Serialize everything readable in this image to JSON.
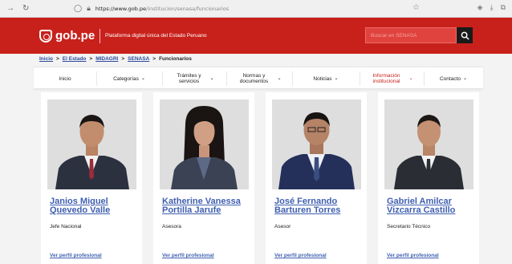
{
  "browser": {
    "url_host": "https://www.gob.pe",
    "url_path": "/institucion/senasa/funcionarios"
  },
  "header": {
    "logo_text": "gob.pe",
    "tagline": "Plataforma digital única del Estado Peruano",
    "search_placeholder": "Buscar en SENASA",
    "brand_color": "#c8211c"
  },
  "breadcrumb": [
    "Inicio",
    "El Estado",
    "MIDAGRI",
    "SENASA",
    "Funcionarios"
  ],
  "menu": [
    {
      "label": "Inicio",
      "chevron": ""
    },
    {
      "label": "Categorías",
      "chevron": "⌄"
    },
    {
      "label": "Trámites y servicios",
      "chevron": "⌄"
    },
    {
      "label": "Normas y documentos",
      "chevron": "⌄"
    },
    {
      "label": "Noticias",
      "chevron": "⌄"
    },
    {
      "label": "Información institucional",
      "chevron": "⌄"
    },
    {
      "label": "Contacto",
      "chevron": "⌄"
    }
  ],
  "officials": [
    {
      "name": "Janios Miguel Quevedo Valle",
      "role": "Jefe Nacional",
      "link": "Ver perfil profesional"
    },
    {
      "name": "Katherine Vanessa Portilla Jarufe",
      "role": "Asesora",
      "link": "Ver perfil profesional"
    },
    {
      "name": "José Fernando Barturen Torres",
      "role": "Asesor",
      "link": "Ver perfil profesional"
    },
    {
      "name": "Gabriel Amilcar Vizcarra Castillo",
      "role": "Secretario Técnico",
      "link": "Ver perfil profesional"
    }
  ]
}
